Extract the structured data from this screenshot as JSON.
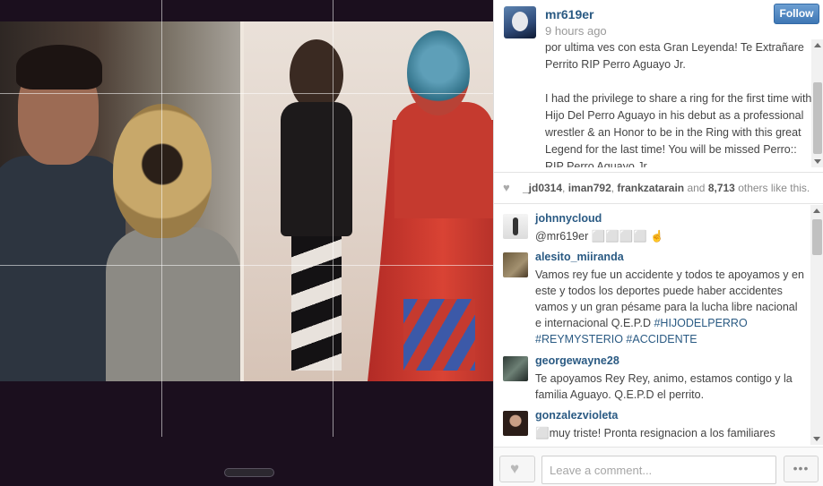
{
  "post": {
    "owner": "mr619er",
    "time_ago": "9 hours ago",
    "follow_label": "Follow",
    "caption_paragraphs": [
      "por ultima ves con esta Gran Leyenda! Te Extrañare Perrito RIP Perro Aguayo Jr.",
      "I had the privilege to share a ring for the first time with Hijo Del Perro Aguayo in his debut as a professional wrestler & an Honor to be in the Ring with this great Legend for the last time! You will be missed Perro:: RIP Perro Aguayo Jr."
    ]
  },
  "likes": {
    "users": [
      "_jd0314",
      "iman792",
      "frankzatarain"
    ],
    "count": "8,713",
    "suffix": "others like this.",
    "sep1": ", ",
    "sep2": ", ",
    "and_word": " and ",
    "space": " "
  },
  "comments": [
    {
      "user": "johnnycloud",
      "text": "@mr619er ⬜⬜⬜⬜ ☝",
      "tags": []
    },
    {
      "user": "alesito_miiranda",
      "text": "Vamos rey fue un accidente y todos te apoyamos y en este y todos los deportes puede haber accidentes vamos y un gran pésame para la lucha libre nacional e internacional Q.E.P.D ",
      "tags": [
        "#HIJODELPERRO",
        "#REYMYSTERIO",
        "#ACCIDENTE"
      ]
    },
    {
      "user": "georgewayne28",
      "text": "Te apoyamos Rey Rey, animo, estamos contigo y la familia Aguayo. Q.E.P.D el perrito.",
      "tags": []
    },
    {
      "user": "gonzalezvioleta",
      "text": "⬜muy triste! Pronta resignacion a los familiares",
      "tags": []
    }
  ],
  "footer": {
    "comment_placeholder": "Leave a comment...",
    "more_label": "•••"
  },
  "icons": {
    "heart": "heart-icon",
    "more": "more-dots-icon"
  },
  "colors": {
    "link": "#2a5a83",
    "follow": "#3f77b5",
    "stage_bg": "#1b0f1e"
  }
}
